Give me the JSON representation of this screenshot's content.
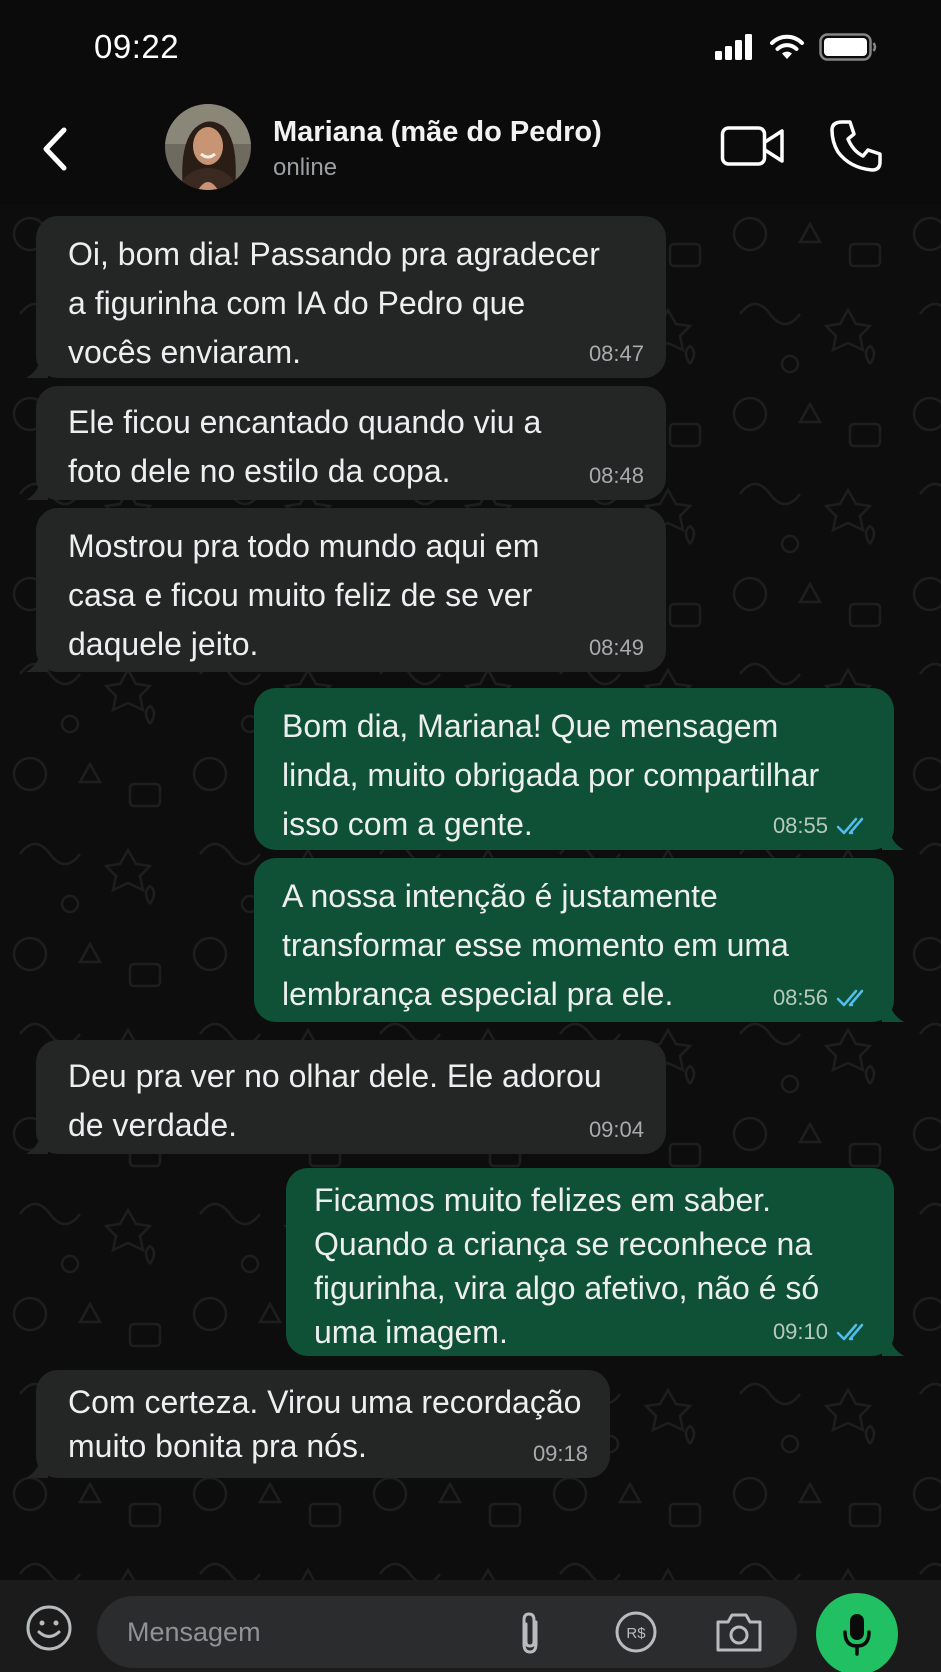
{
  "status_bar": {
    "time": "09:22"
  },
  "header": {
    "contact_name": "Mariana (mãe do Pedro)",
    "contact_status": "online"
  },
  "messages": [
    {
      "direction": "in",
      "lines": [
        "Oi, bom dia! Passando pra agradecer",
        "a figurinha com IA do Pedro que",
        "vocês enviaram."
      ],
      "time": "08:47"
    },
    {
      "direction": "in",
      "lines": [
        "Ele ficou encantado quando viu a",
        "foto dele no estilo da copa."
      ],
      "time": "08:48"
    },
    {
      "direction": "in",
      "lines": [
        "Mostrou pra todo mundo aqui em",
        "casa e ficou muito feliz de se ver",
        "daquele jeito."
      ],
      "time": "08:49"
    },
    {
      "direction": "out",
      "lines": [
        "Bom dia, Mariana! Que mensagem",
        "linda, muito obrigada por compartilhar",
        "isso com a gente."
      ],
      "time": "08:55",
      "status": "read"
    },
    {
      "direction": "out",
      "lines": [
        "A nossa intenção é justamente",
        "transformar esse momento em uma",
        "lembrança especial pra ele."
      ],
      "time": "08:56",
      "status": "read"
    },
    {
      "direction": "in",
      "lines": [
        "Deu pra ver no olhar dele. Ele adorou",
        "de verdade."
      ],
      "time": "09:04"
    },
    {
      "direction": "out",
      "lines": [
        "Ficamos muito felizes em saber.",
        "Quando a criança se reconhece na",
        "figurinha, vira algo afetivo, não é só",
        "uma imagem."
      ],
      "time": "09:10",
      "status": "read"
    },
    {
      "direction": "in",
      "lines": [
        "Com certeza. Virou uma recordação",
        "muito bonita pra nós."
      ],
      "time": "09:18"
    }
  ],
  "input": {
    "placeholder": "Mensagem"
  },
  "colors": {
    "incoming_bubble": "#242626",
    "outgoing_bubble": "#0f5136",
    "accent": "#21c063",
    "read_ticks": "#53bdeb"
  }
}
